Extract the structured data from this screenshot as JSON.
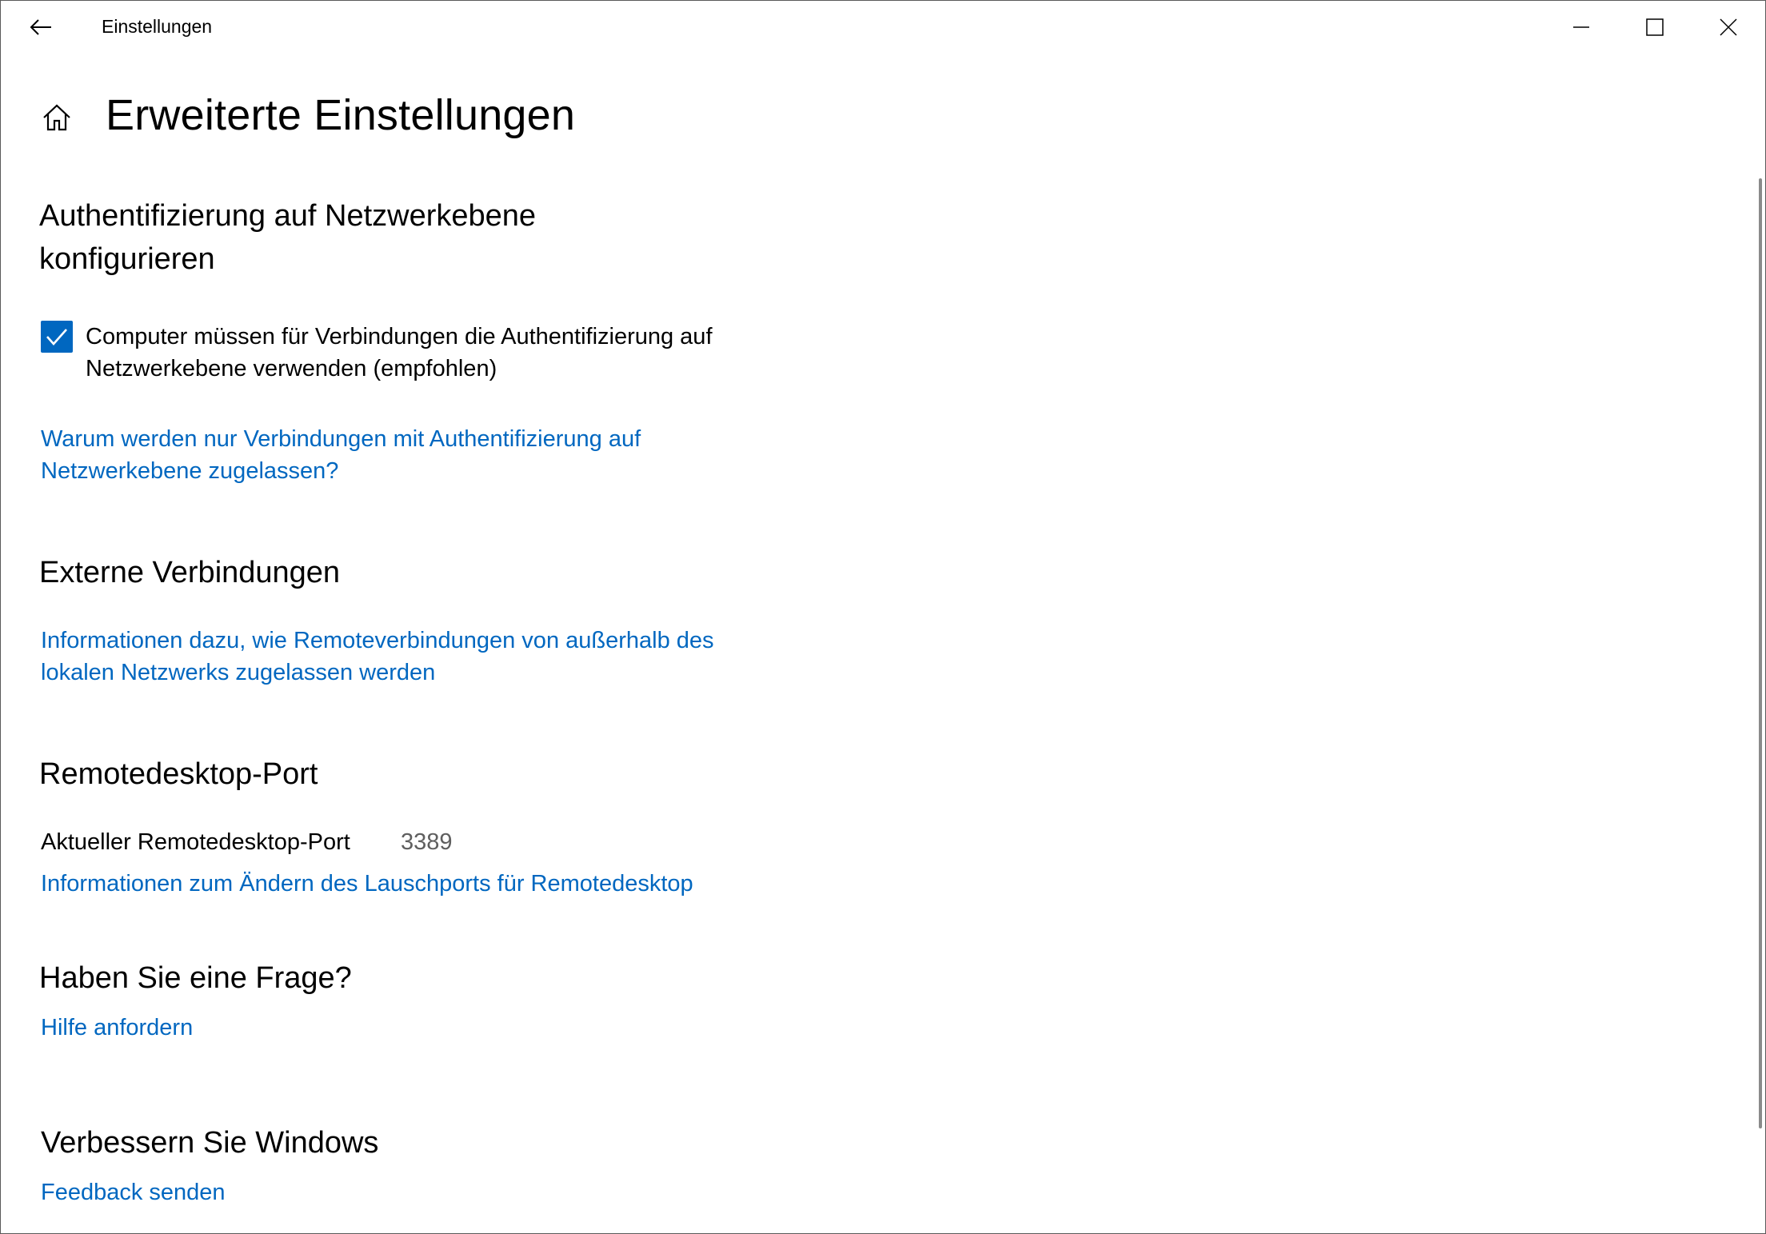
{
  "window": {
    "title": "Einstellungen",
    "back_icon": "back-arrow-icon",
    "controls": [
      "minimize-icon",
      "maximize-icon",
      "close-icon"
    ]
  },
  "page": {
    "title": "Erweiterte Einstellungen",
    "home_icon": "home-icon"
  },
  "nla": {
    "heading": "Authentifizierung auf Netzwerkebene konfigurieren",
    "checkbox_checked": true,
    "checkbox_label": "Computer müssen für Verbindungen die Authentifizierung auf Netzwerkebene verwenden (empfohlen)",
    "link": "Warum werden nur Verbindungen mit Authentifizierung auf Netzwerkebene zugelassen?"
  },
  "external": {
    "heading": "Externe Verbindungen",
    "link": "Informationen dazu, wie Remoteverbindungen von außerhalb des lokalen Netzwerks zugelassen werden"
  },
  "port": {
    "heading": "Remotedesktop-Port",
    "label": "Aktueller Remotedesktop-Port",
    "value": "3389",
    "link": "Informationen zum Ändern des Lauschports für Remotedesktop"
  },
  "question": {
    "heading": "Haben Sie eine Frage?",
    "link": "Hilfe anfordern"
  },
  "improve": {
    "heading": "Verbessern Sie Windows",
    "link": "Feedback senden"
  },
  "colors": {
    "accent": "#0067c0",
    "secondary_text": "#5f5f5f"
  }
}
